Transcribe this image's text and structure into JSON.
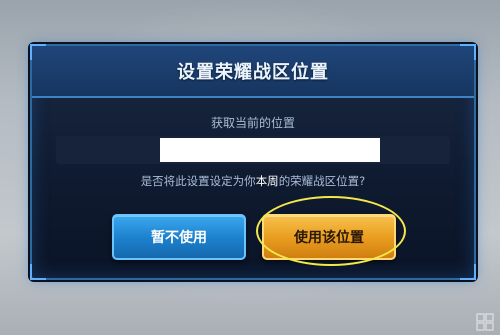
{
  "dialog": {
    "title": "设置荣耀战区位置",
    "subtitle": "获取当前的位置",
    "location_value": "",
    "question_pre": "是否将此设置设定为你",
    "question_highlight": "本周",
    "question_post": "的荣耀战区位置?",
    "cancel_label": "暂不使用",
    "confirm_label": "使用该位置"
  },
  "colors": {
    "dialog_bg": "#0f1b30",
    "header_bg": "#1d3f70",
    "border": "#2e6aa0",
    "cancel_button": "#1c7fcc",
    "confirm_button": "#e79b1e",
    "highlight_ring": "#f3e84a"
  }
}
